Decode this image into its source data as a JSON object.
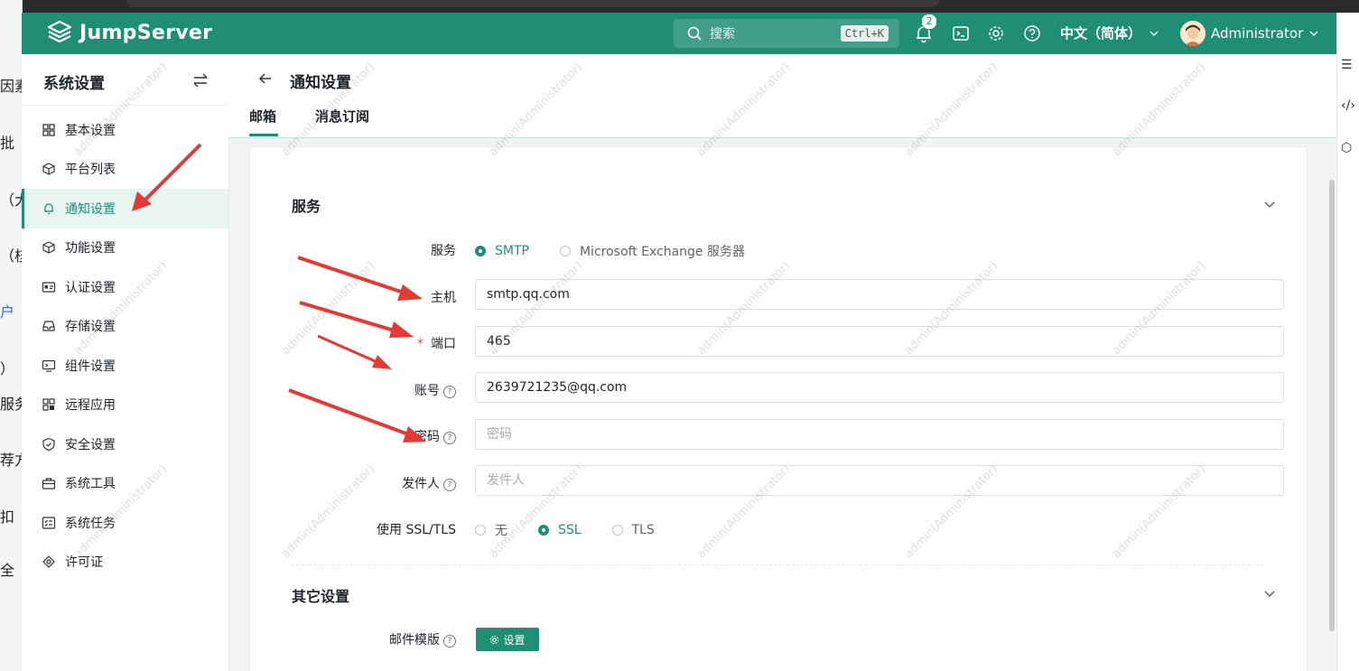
{
  "background": {
    "left_fragments": [
      "因素",
      "批",
      "（大",
      "（核",
      "户",
      "）",
      "服务",
      "荐方",
      "扣",
      "全"
    ]
  },
  "header": {
    "logo_text": "JumpServer",
    "search_placeholder": "搜索",
    "search_shortcut": "Ctrl+K",
    "notification_count": "2",
    "language": "中文（简体）",
    "user_name": "Administrator"
  },
  "sidebar": {
    "title": "系统设置",
    "items": [
      {
        "label": "基本设置",
        "icon": "grid-icon"
      },
      {
        "label": "平台列表",
        "icon": "cube-icon"
      },
      {
        "label": "通知设置",
        "icon": "bell-icon",
        "active": true
      },
      {
        "label": "功能设置",
        "icon": "cube-icon"
      },
      {
        "label": "认证设置",
        "icon": "id-card-icon"
      },
      {
        "label": "存储设置",
        "icon": "inbox-icon"
      },
      {
        "label": "组件设置",
        "icon": "monitor-icon"
      },
      {
        "label": "远程应用",
        "icon": "apps-icon"
      },
      {
        "label": "安全设置",
        "icon": "shield-icon"
      },
      {
        "label": "系统工具",
        "icon": "toolbox-icon"
      },
      {
        "label": "系统任务",
        "icon": "task-list-icon"
      },
      {
        "label": "许可证",
        "icon": "badge-icon"
      }
    ]
  },
  "page": {
    "title": "通知设置",
    "tabs": [
      {
        "label": "邮箱",
        "active": true
      },
      {
        "label": "消息订阅",
        "active": false
      }
    ]
  },
  "form": {
    "service_section": "服务",
    "service_label": "服务",
    "service_options": [
      {
        "label": "SMTP",
        "selected": true
      },
      {
        "label": "Microsoft Exchange 服务器",
        "selected": false
      }
    ],
    "host_label": "主机",
    "host_value": "smtp.qq.com",
    "port_label": "端口",
    "port_value": "465",
    "account_label": "账号",
    "account_value": "2639721235@qq.com",
    "password_label": "密码",
    "password_placeholder": "密码",
    "sender_label": "发件人",
    "sender_placeholder": "发件人",
    "ssl_label": "使用 SSL/TLS",
    "ssl_options": [
      {
        "label": "无",
        "selected": false
      },
      {
        "label": "SSL",
        "selected": true
      },
      {
        "label": "TLS",
        "selected": false
      }
    ],
    "other_section": "其它设置",
    "template_label": "邮件模版",
    "template_button": "设置"
  },
  "watermark": "admin(Administrator)",
  "colors": {
    "brand": "#1f8e75",
    "annotation_arrow": "#e53935"
  }
}
